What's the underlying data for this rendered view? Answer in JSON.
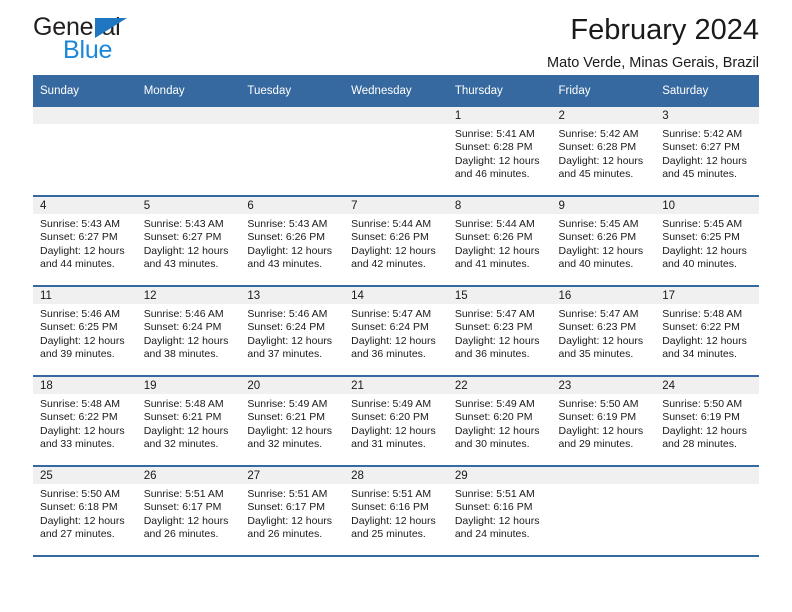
{
  "brand": {
    "name_top": "General",
    "name_bottom": "Blue",
    "triangle_color": "#1f77c2",
    "blue_text_color": "#1b87d8"
  },
  "header": {
    "title": "February 2024",
    "subtitle": "Mato Verde, Minas Gerais, Brazil",
    "header_bg": "#36699f",
    "day_band_bg": "#f0f0f0"
  },
  "weekdays": [
    "Sunday",
    "Monday",
    "Tuesday",
    "Wednesday",
    "Thursday",
    "Friday",
    "Saturday"
  ],
  "labels": {
    "sunrise_prefix": "Sunrise: ",
    "sunset_prefix": "Sunset: ",
    "daylight_prefix": "Daylight: "
  },
  "weeks": [
    [
      {
        "empty": true
      },
      {
        "empty": true
      },
      {
        "empty": true
      },
      {
        "empty": true
      },
      {
        "day": "1",
        "sunrise": "Sunrise: 5:41 AM",
        "sunset": "Sunset: 6:28 PM",
        "daylight1": "Daylight: 12 hours",
        "daylight2": "and 46 minutes."
      },
      {
        "day": "2",
        "sunrise": "Sunrise: 5:42 AM",
        "sunset": "Sunset: 6:28 PM",
        "daylight1": "Daylight: 12 hours",
        "daylight2": "and 45 minutes."
      },
      {
        "day": "3",
        "sunrise": "Sunrise: 5:42 AM",
        "sunset": "Sunset: 6:27 PM",
        "daylight1": "Daylight: 12 hours",
        "daylight2": "and 45 minutes."
      }
    ],
    [
      {
        "day": "4",
        "sunrise": "Sunrise: 5:43 AM",
        "sunset": "Sunset: 6:27 PM",
        "daylight1": "Daylight: 12 hours",
        "daylight2": "and 44 minutes."
      },
      {
        "day": "5",
        "sunrise": "Sunrise: 5:43 AM",
        "sunset": "Sunset: 6:27 PM",
        "daylight1": "Daylight: 12 hours",
        "daylight2": "and 43 minutes."
      },
      {
        "day": "6",
        "sunrise": "Sunrise: 5:43 AM",
        "sunset": "Sunset: 6:26 PM",
        "daylight1": "Daylight: 12 hours",
        "daylight2": "and 43 minutes."
      },
      {
        "day": "7",
        "sunrise": "Sunrise: 5:44 AM",
        "sunset": "Sunset: 6:26 PM",
        "daylight1": "Daylight: 12 hours",
        "daylight2": "and 42 minutes."
      },
      {
        "day": "8",
        "sunrise": "Sunrise: 5:44 AM",
        "sunset": "Sunset: 6:26 PM",
        "daylight1": "Daylight: 12 hours",
        "daylight2": "and 41 minutes."
      },
      {
        "day": "9",
        "sunrise": "Sunrise: 5:45 AM",
        "sunset": "Sunset: 6:26 PM",
        "daylight1": "Daylight: 12 hours",
        "daylight2": "and 40 minutes."
      },
      {
        "day": "10",
        "sunrise": "Sunrise: 5:45 AM",
        "sunset": "Sunset: 6:25 PM",
        "daylight1": "Daylight: 12 hours",
        "daylight2": "and 40 minutes."
      }
    ],
    [
      {
        "day": "11",
        "sunrise": "Sunrise: 5:46 AM",
        "sunset": "Sunset: 6:25 PM",
        "daylight1": "Daylight: 12 hours",
        "daylight2": "and 39 minutes."
      },
      {
        "day": "12",
        "sunrise": "Sunrise: 5:46 AM",
        "sunset": "Sunset: 6:24 PM",
        "daylight1": "Daylight: 12 hours",
        "daylight2": "and 38 minutes."
      },
      {
        "day": "13",
        "sunrise": "Sunrise: 5:46 AM",
        "sunset": "Sunset: 6:24 PM",
        "daylight1": "Daylight: 12 hours",
        "daylight2": "and 37 minutes."
      },
      {
        "day": "14",
        "sunrise": "Sunrise: 5:47 AM",
        "sunset": "Sunset: 6:24 PM",
        "daylight1": "Daylight: 12 hours",
        "daylight2": "and 36 minutes."
      },
      {
        "day": "15",
        "sunrise": "Sunrise: 5:47 AM",
        "sunset": "Sunset: 6:23 PM",
        "daylight1": "Daylight: 12 hours",
        "daylight2": "and 36 minutes."
      },
      {
        "day": "16",
        "sunrise": "Sunrise: 5:47 AM",
        "sunset": "Sunset: 6:23 PM",
        "daylight1": "Daylight: 12 hours",
        "daylight2": "and 35 minutes."
      },
      {
        "day": "17",
        "sunrise": "Sunrise: 5:48 AM",
        "sunset": "Sunset: 6:22 PM",
        "daylight1": "Daylight: 12 hours",
        "daylight2": "and 34 minutes."
      }
    ],
    [
      {
        "day": "18",
        "sunrise": "Sunrise: 5:48 AM",
        "sunset": "Sunset: 6:22 PM",
        "daylight1": "Daylight: 12 hours",
        "daylight2": "and 33 minutes."
      },
      {
        "day": "19",
        "sunrise": "Sunrise: 5:48 AM",
        "sunset": "Sunset: 6:21 PM",
        "daylight1": "Daylight: 12 hours",
        "daylight2": "and 32 minutes."
      },
      {
        "day": "20",
        "sunrise": "Sunrise: 5:49 AM",
        "sunset": "Sunset: 6:21 PM",
        "daylight1": "Daylight: 12 hours",
        "daylight2": "and 32 minutes."
      },
      {
        "day": "21",
        "sunrise": "Sunrise: 5:49 AM",
        "sunset": "Sunset: 6:20 PM",
        "daylight1": "Daylight: 12 hours",
        "daylight2": "and 31 minutes."
      },
      {
        "day": "22",
        "sunrise": "Sunrise: 5:49 AM",
        "sunset": "Sunset: 6:20 PM",
        "daylight1": "Daylight: 12 hours",
        "daylight2": "and 30 minutes."
      },
      {
        "day": "23",
        "sunrise": "Sunrise: 5:50 AM",
        "sunset": "Sunset: 6:19 PM",
        "daylight1": "Daylight: 12 hours",
        "daylight2": "and 29 minutes."
      },
      {
        "day": "24",
        "sunrise": "Sunrise: 5:50 AM",
        "sunset": "Sunset: 6:19 PM",
        "daylight1": "Daylight: 12 hours",
        "daylight2": "and 28 minutes."
      }
    ],
    [
      {
        "day": "25",
        "sunrise": "Sunrise: 5:50 AM",
        "sunset": "Sunset: 6:18 PM",
        "daylight1": "Daylight: 12 hours",
        "daylight2": "and 27 minutes."
      },
      {
        "day": "26",
        "sunrise": "Sunrise: 5:51 AM",
        "sunset": "Sunset: 6:17 PM",
        "daylight1": "Daylight: 12 hours",
        "daylight2": "and 26 minutes."
      },
      {
        "day": "27",
        "sunrise": "Sunrise: 5:51 AM",
        "sunset": "Sunset: 6:17 PM",
        "daylight1": "Daylight: 12 hours",
        "daylight2": "and 26 minutes."
      },
      {
        "day": "28",
        "sunrise": "Sunrise: 5:51 AM",
        "sunset": "Sunset: 6:16 PM",
        "daylight1": "Daylight: 12 hours",
        "daylight2": "and 25 minutes."
      },
      {
        "day": "29",
        "sunrise": "Sunrise: 5:51 AM",
        "sunset": "Sunset: 6:16 PM",
        "daylight1": "Daylight: 12 hours",
        "daylight2": "and 24 minutes."
      },
      {
        "empty": true
      },
      {
        "empty": true
      }
    ]
  ]
}
